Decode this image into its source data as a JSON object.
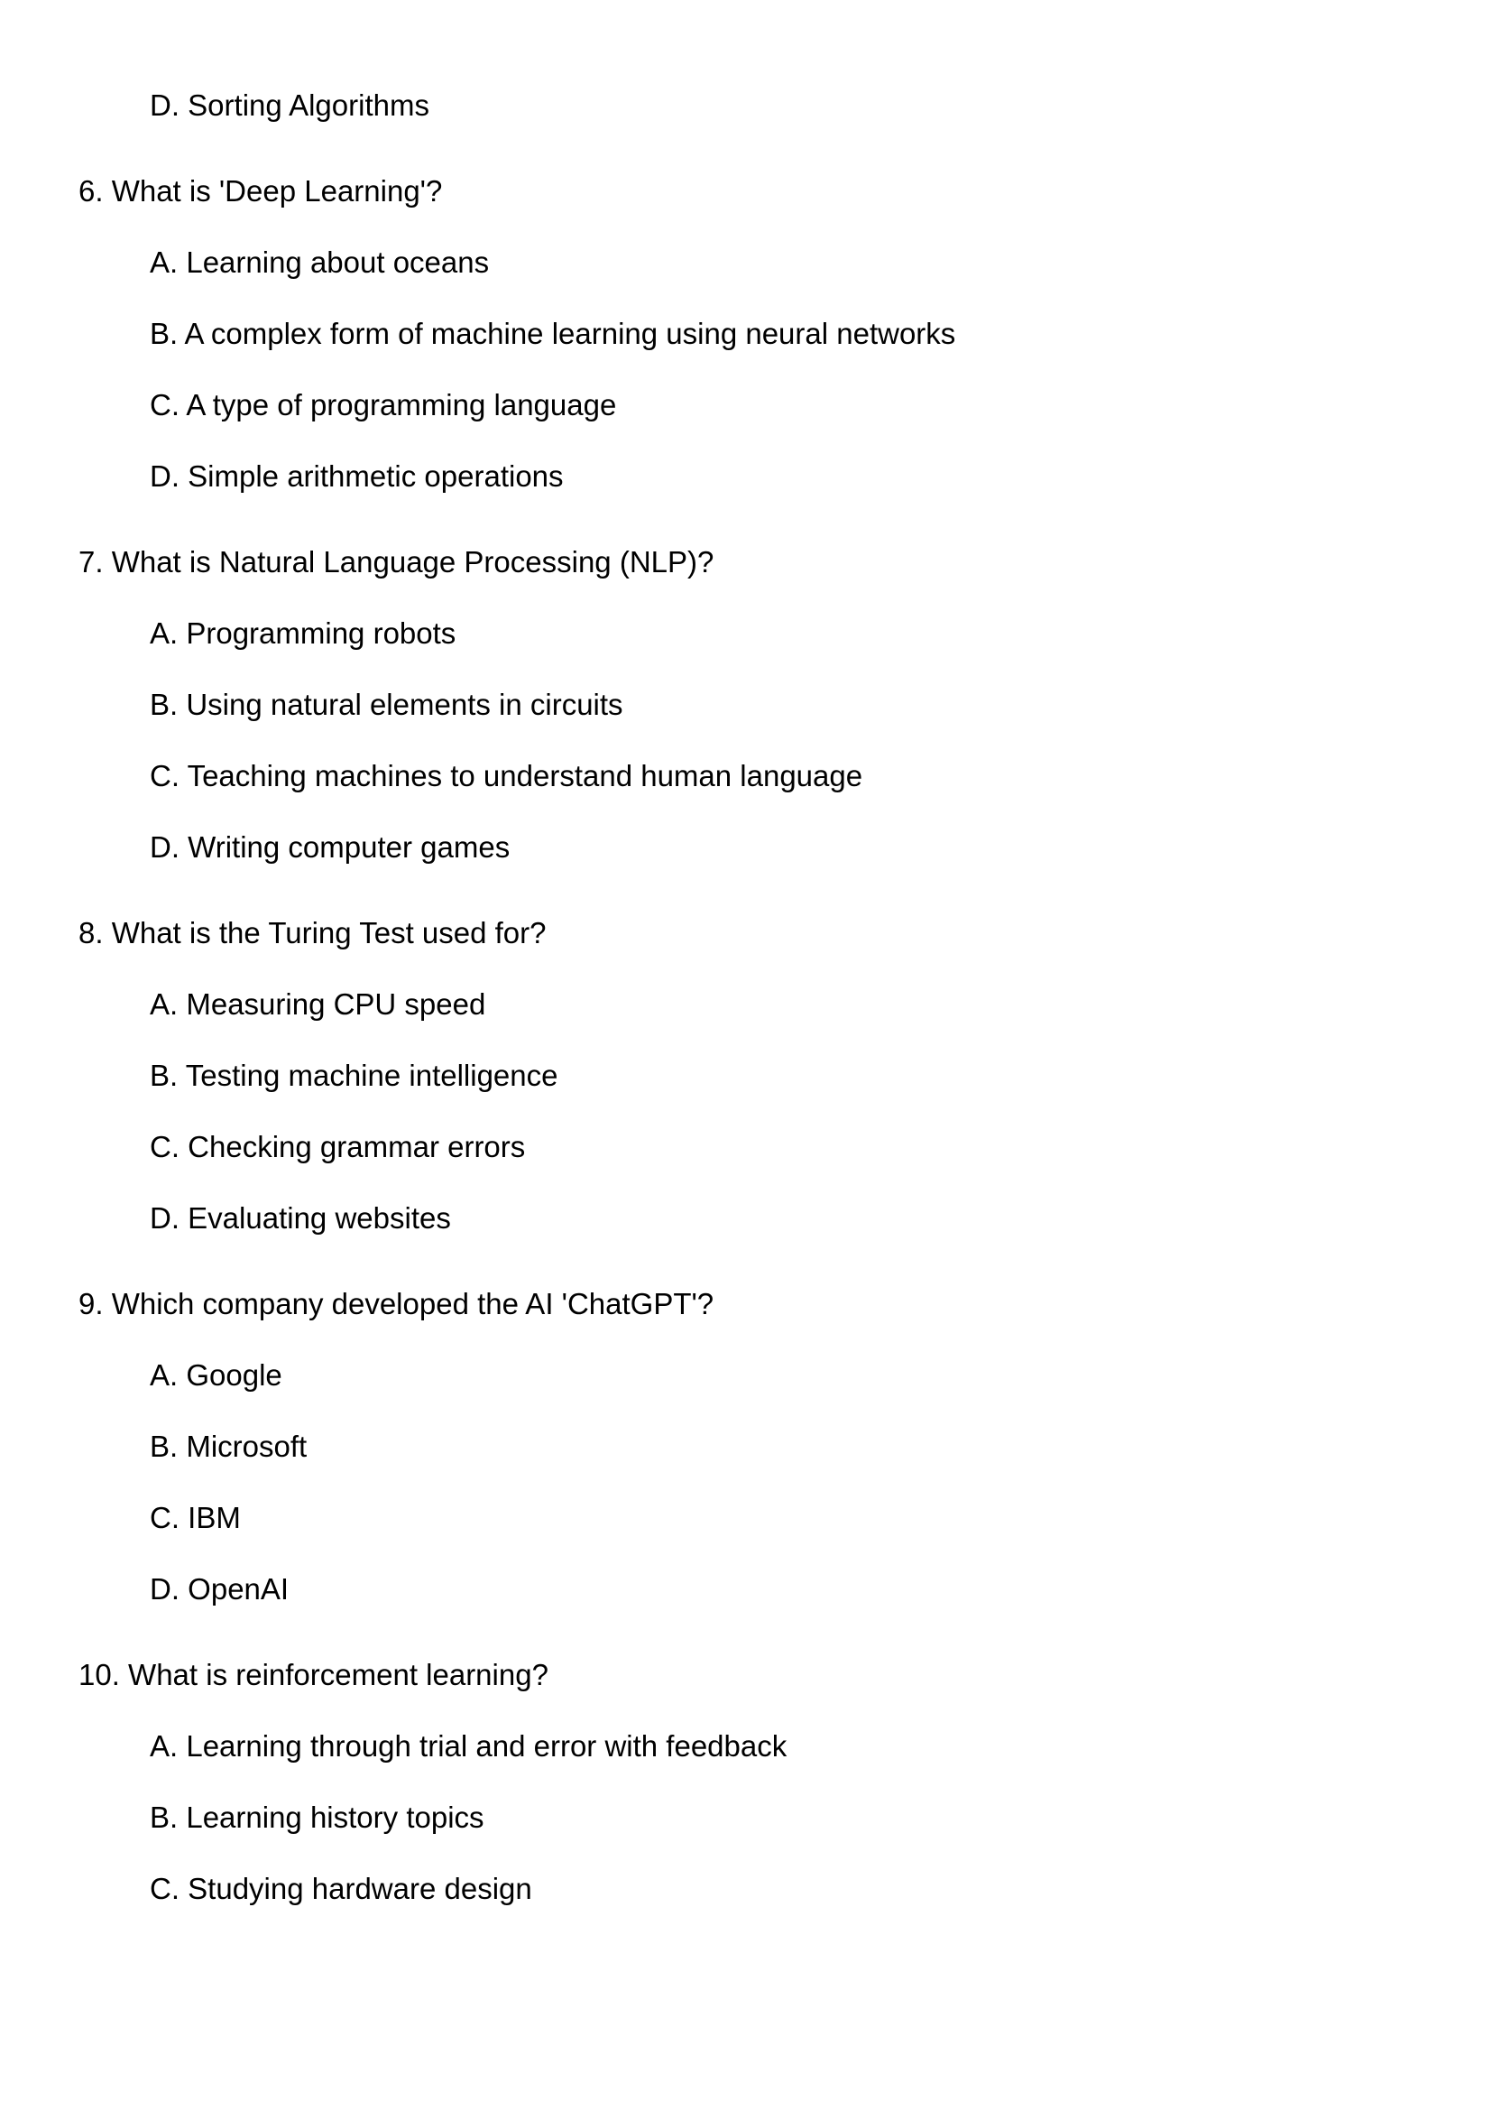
{
  "leading_options": [
    {
      "label": "D. Sorting Algorithms"
    }
  ],
  "questions": [
    {
      "text": "6. What is 'Deep Learning'?",
      "options": [
        "A. Learning about oceans",
        "B. A complex form of machine learning using neural networks",
        "C. A type of programming language",
        "D. Simple arithmetic operations"
      ]
    },
    {
      "text": "7. What is Natural Language Processing (NLP)?",
      "options": [
        "A. Programming robots",
        "B. Using natural elements in circuits",
        "C. Teaching machines to understand human language",
        "D. Writing computer games"
      ]
    },
    {
      "text": "8. What is the Turing Test used for?",
      "options": [
        "A. Measuring CPU speed",
        "B. Testing machine intelligence",
        "C. Checking grammar errors",
        "D. Evaluating websites"
      ]
    },
    {
      "text": "9. Which company developed the AI 'ChatGPT'?",
      "options": [
        "A. Google",
        "B. Microsoft",
        "C. IBM",
        "D. OpenAI"
      ]
    },
    {
      "text": "10. What is reinforcement learning?",
      "options": [
        "A. Learning through trial and error with feedback",
        "B. Learning history topics",
        "C. Studying hardware design"
      ]
    }
  ]
}
